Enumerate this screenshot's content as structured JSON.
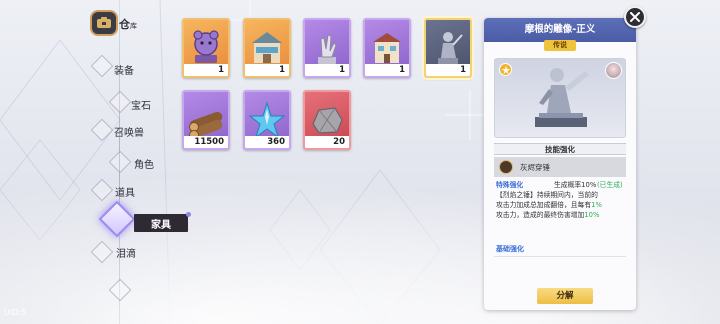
{
  "nav": {
    "header": {
      "title": "仓",
      "subtitle": "库"
    },
    "items": [
      {
        "label": "装备"
      },
      {
        "label": "宝石"
      },
      {
        "label": "召唤兽"
      },
      {
        "label": "角色"
      },
      {
        "label": "道具"
      },
      {
        "label": "家具",
        "active": true
      },
      {
        "label": "泪滴"
      }
    ]
  },
  "inventory": {
    "items": [
      {
        "icon": "bear-statue-icon",
        "quality": "orange",
        "count": "1"
      },
      {
        "icon": "shop-building-icon",
        "quality": "orange",
        "count": "1"
      },
      {
        "icon": "hand-sculpture-icon",
        "quality": "purple",
        "count": "1"
      },
      {
        "icon": "house-building-icon",
        "quality": "purple",
        "count": "1"
      },
      {
        "icon": "statue-icon",
        "quality": "gold",
        "count": "1",
        "selected": true
      },
      {
        "icon": "wood-logs-icon",
        "quality": "purple",
        "count": "11500"
      },
      {
        "icon": "blue-star-icon",
        "quality": "purple",
        "count": "360"
      },
      {
        "icon": "stone-ore-icon",
        "quality": "red",
        "count": "20"
      }
    ]
  },
  "detail": {
    "title": "摩根的雕像-正义",
    "rarity": "传说",
    "skill_header": "技能强化",
    "skill_name": "灰烬穿锤",
    "desc": {
      "special_label": "特殊强化",
      "gen_rate": "生成概率10%",
      "gen_status": "(已生成)",
      "line2": "【烈焰之锤】持续期间内，当前的",
      "line3_a": "攻击力加成总加成翻倍，且每有",
      "line3_pct": "1%",
      "line4_a": "攻击力，造成的最终伤害增加",
      "line4_pct": "10%"
    },
    "basic_label": "基础强化",
    "decompose_label": "分解"
  },
  "footer": {
    "uid": "UID:5"
  },
  "colors": {
    "accent_blue": "#4a5ca6",
    "gold": "#eebd45",
    "active_purple": "#9a8cf0"
  }
}
